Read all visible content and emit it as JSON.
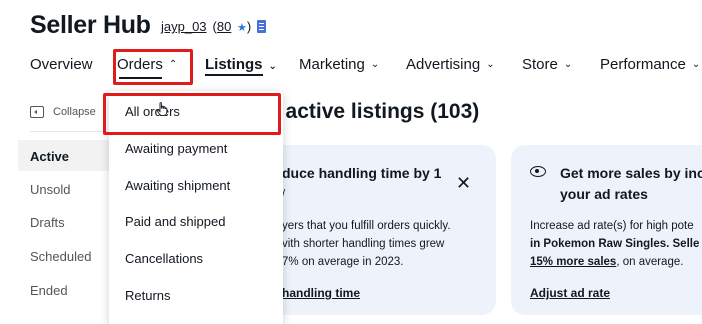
{
  "header": {
    "title": "Seller Hub",
    "username": "jayp_03",
    "feedback_open": "(",
    "feedback_score": "80",
    "feedback_close": ")",
    "star": "★"
  },
  "nav": {
    "items": [
      {
        "label": "Overview",
        "chevron": ""
      },
      {
        "label": "Orders",
        "chevron": "⌃"
      },
      {
        "label": "Listings",
        "chevron": "⌄"
      },
      {
        "label": "Marketing",
        "chevron": "⌄"
      },
      {
        "label": "Advertising",
        "chevron": "⌄"
      },
      {
        "label": "Store",
        "chevron": "⌄"
      },
      {
        "label": "Performance",
        "chevron": "⌄"
      }
    ]
  },
  "orders_menu": {
    "items": [
      "All orders",
      "Awaiting payment",
      "Awaiting shipment",
      "Paid and shipped",
      "Cancellations",
      "Returns"
    ]
  },
  "sidebar": {
    "collapse_label": "Collapse",
    "items": [
      "Active",
      "Unsold",
      "Drafts",
      "Scheduled",
      "Ended"
    ]
  },
  "main": {
    "heading": "e active listings (103)"
  },
  "cards": [
    {
      "title_lines": [
        "duce handling time by 1",
        "/"
      ],
      "body_lines": [
        "yers that you fulfill orders quickly.",
        "vith shorter handling times grew",
        "7% on average in 2023."
      ],
      "link": "handling time",
      "close": "✕"
    },
    {
      "title_lines": [
        "Get more sales by inc",
        "your ad rates"
      ],
      "body_lines": [
        "Increase ad rate(s) for high pote",
        "in Pokemon Raw Singles. Selle",
        "15% more sales",
        ", on average."
      ],
      "link": "Adjust ad rate"
    }
  ],
  "colors": {
    "highlight": "#e11a1a",
    "card_bg": "#eef3fb",
    "star": "#2a7bd3"
  }
}
